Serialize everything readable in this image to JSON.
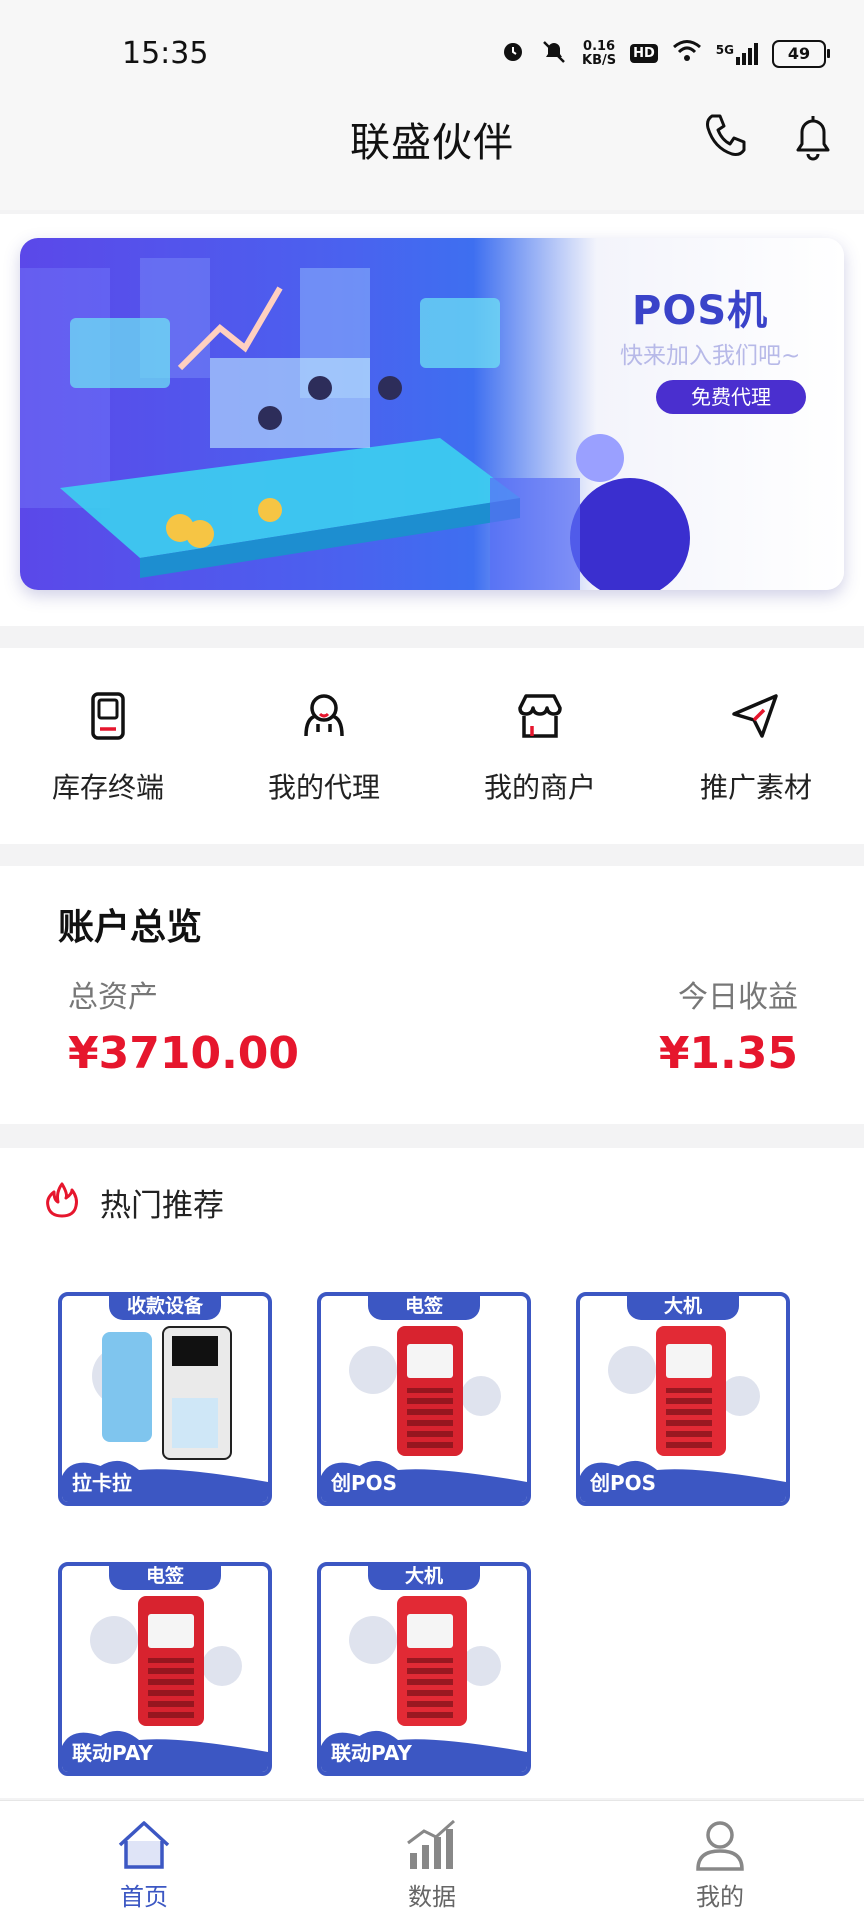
{
  "status_bar": {
    "time": "15:35",
    "speed_value": "0.16",
    "speed_unit": "KB/S",
    "hd": "HD",
    "network": "5G",
    "battery": "49"
  },
  "header": {
    "title": "联盛伙伴"
  },
  "banner": {
    "title": "POS机",
    "subtitle": "快来加入我们吧~",
    "button": "免费代理"
  },
  "quick_menu": [
    {
      "label": "库存终端",
      "icon": "terminal-icon"
    },
    {
      "label": "我的代理",
      "icon": "agent-icon"
    },
    {
      "label": "我的商户",
      "icon": "store-icon"
    },
    {
      "label": "推广素材",
      "icon": "send-icon"
    }
  ],
  "account": {
    "title": "账户总览",
    "total_label": "总资产",
    "total_value": "¥3710.00",
    "today_label": "今日收益",
    "today_value": "¥1.35"
  },
  "hot": {
    "title": "热门推荐",
    "products": [
      {
        "tag": "收款设备",
        "name": "拉卡拉"
      },
      {
        "tag": "电签",
        "name": "创POS"
      },
      {
        "tag": "大机",
        "name": "创POS"
      },
      {
        "tag": "电签",
        "name": "联动PAY"
      },
      {
        "tag": "大机",
        "name": "联动PAY"
      }
    ]
  },
  "nav": [
    {
      "label": "首页",
      "active": true
    },
    {
      "label": "数据",
      "active": false
    },
    {
      "label": "我的",
      "active": false
    }
  ],
  "colors": {
    "accent": "#3c57c3",
    "price": "#e6162d",
    "banner_button": "#4a2fcf"
  }
}
